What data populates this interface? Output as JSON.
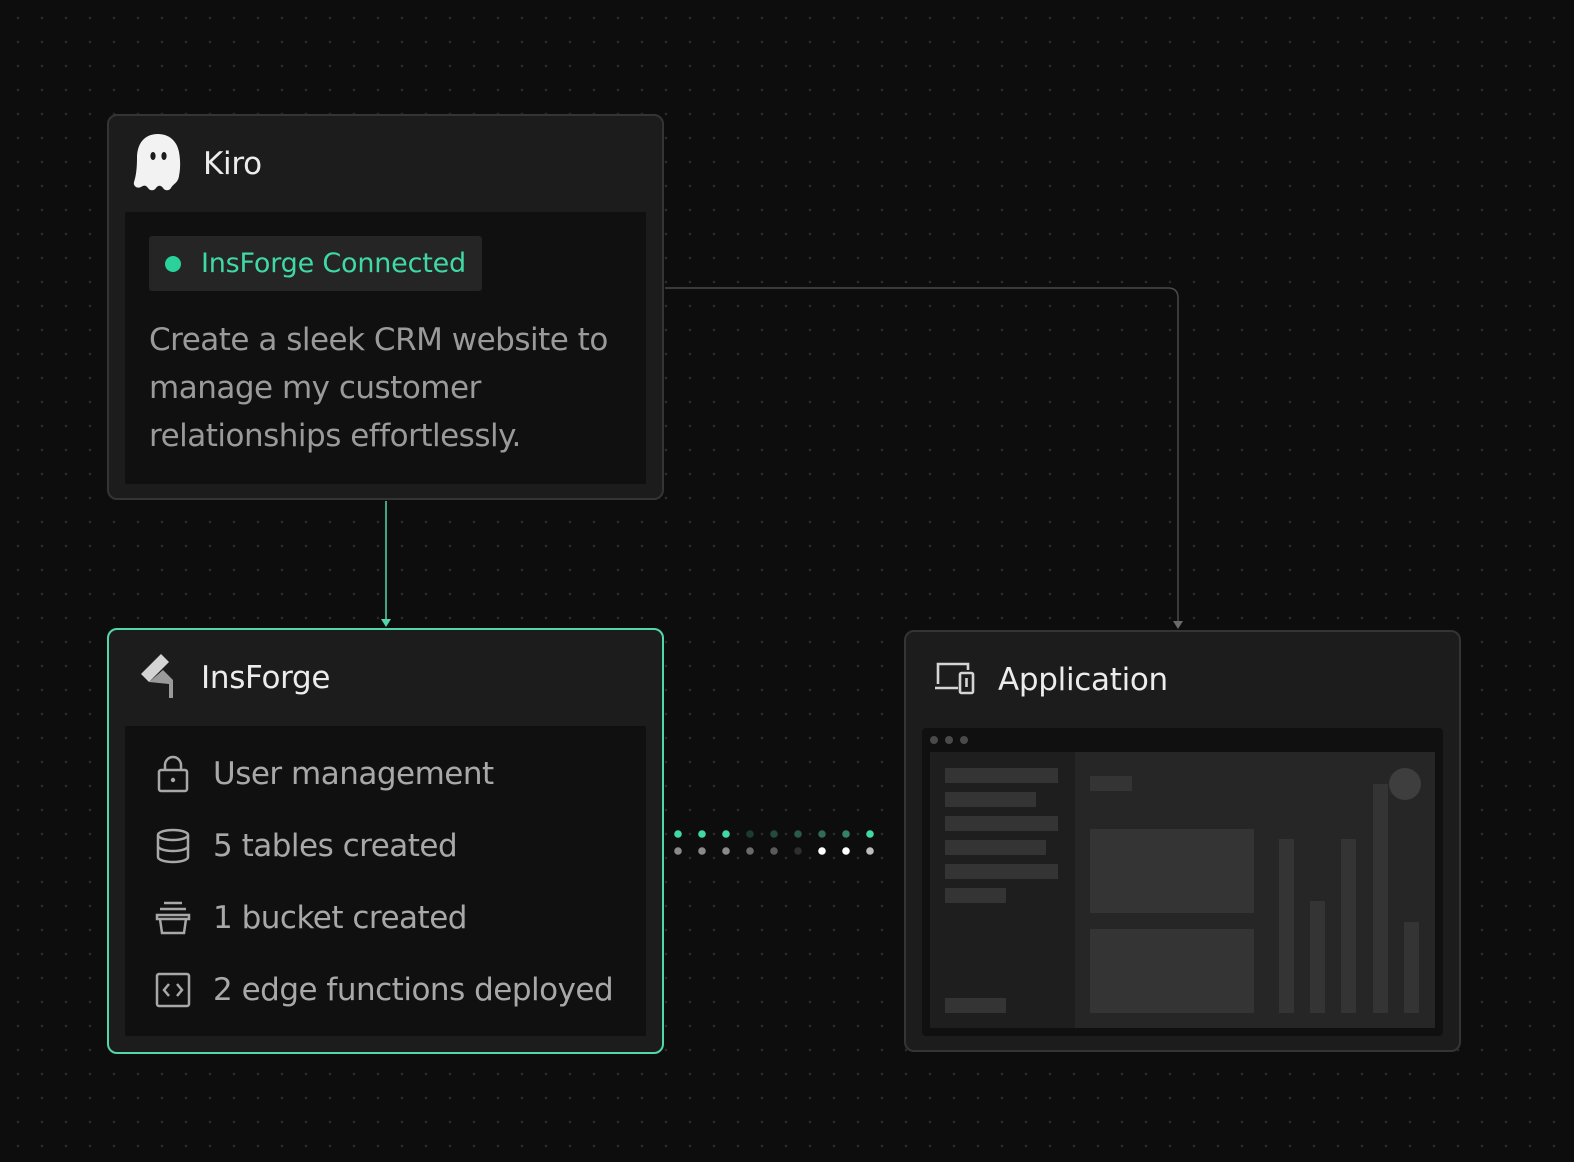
{
  "kiro": {
    "title": "Kiro",
    "icon": "ghost-icon",
    "status": "InsForge Connected",
    "status_color": "#2ad19b",
    "prompt": "Create a sleek CRM website to manage my customer relationships effortlessly."
  },
  "insforge": {
    "title": "InsForge",
    "icon": "insforge-logo-icon",
    "accent_color": "#52d7a8",
    "features": [
      {
        "icon": "lock-icon",
        "label": "User management"
      },
      {
        "icon": "database-icon",
        "label": "5 tables created"
      },
      {
        "icon": "bucket-icon",
        "label": "1 bucket created"
      },
      {
        "icon": "code-icon",
        "label": "2 edge functions deployed"
      }
    ]
  },
  "application": {
    "title": "Application",
    "icon": "devices-icon"
  },
  "connectors": {
    "kiro_to_insforge": "#52d7a8",
    "kiro_to_application": "#4a4a4a"
  }
}
